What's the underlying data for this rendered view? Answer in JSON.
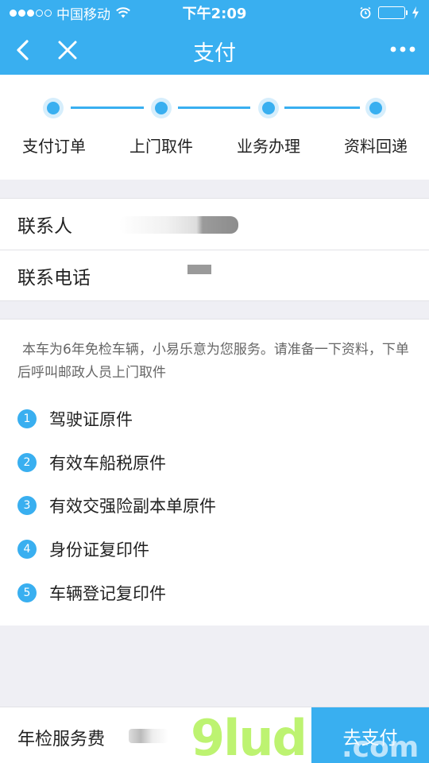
{
  "status_bar": {
    "carrier": "中国移动",
    "time": "下午2:09"
  },
  "nav": {
    "title": "支付",
    "icons": [
      "back-chevron-icon",
      "close-icon",
      "more-dots-icon"
    ]
  },
  "steps": [
    {
      "label": "支付订单"
    },
    {
      "label": "上门取件"
    },
    {
      "label": "业务办理"
    },
    {
      "label": "资料回递"
    }
  ],
  "contact": {
    "name_label": "联系人",
    "phone_label": "联系电话"
  },
  "info": {
    "description": "本车为6年免检车辆，小易乐意为您服务。请准备一下资料，下单后呼叫邮政人员上门取件",
    "items": [
      {
        "num": "1",
        "text": "驾驶证原件"
      },
      {
        "num": "2",
        "text": "有效车船税原件"
      },
      {
        "num": "3",
        "text": "有效交强险副本单原件"
      },
      {
        "num": "4",
        "text": "身份证复印件"
      },
      {
        "num": "5",
        "text": "车辆登记复印件"
      }
    ]
  },
  "footer": {
    "fee_label": "年检服务费",
    "pay_button": "去支付"
  },
  "watermark": {
    "logo": "9lud",
    "suffix": ".com"
  },
  "colors": {
    "accent": "#39aff0",
    "background": "#efeff4"
  }
}
